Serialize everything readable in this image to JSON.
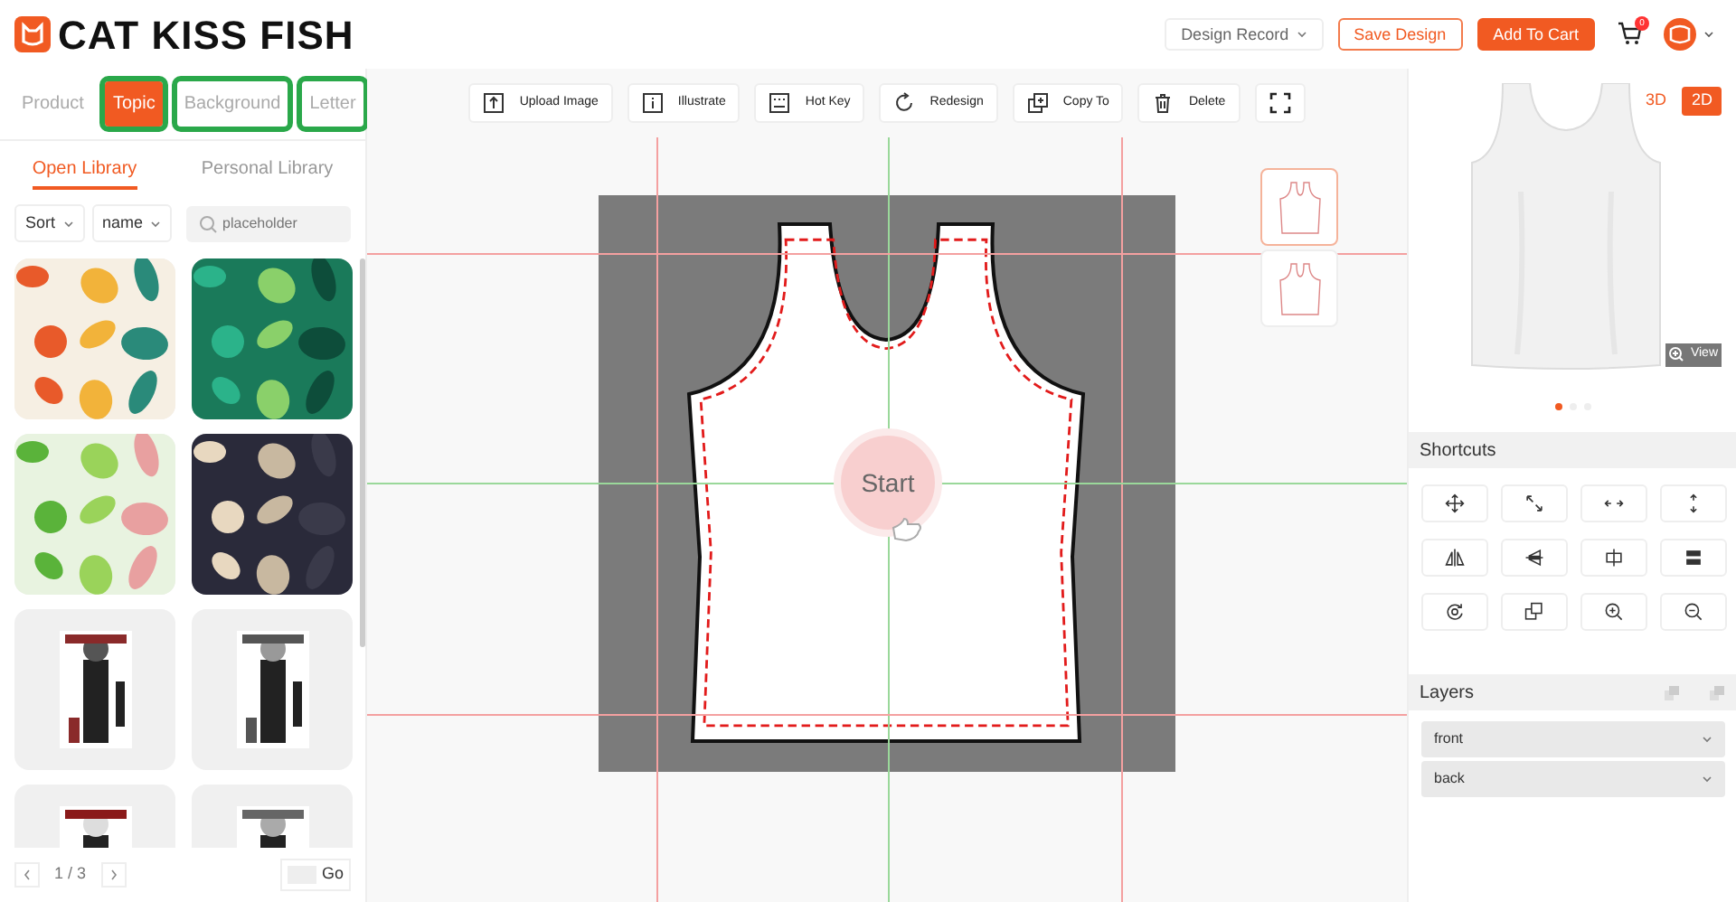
{
  "brand": "CAT KISS FISH",
  "header": {
    "design_record": "Design Record",
    "save": "Save Design",
    "add_to_cart": "Add To Cart",
    "cart_badge": "0"
  },
  "left_tabs": [
    {
      "label": "Product",
      "selected": false,
      "highlighted": false
    },
    {
      "label": "Topic",
      "selected": true,
      "highlighted": true
    },
    {
      "label": "Background",
      "selected": false,
      "highlighted": true
    },
    {
      "label": "Letter",
      "selected": false,
      "highlighted": true
    }
  ],
  "library_tabs": [
    {
      "label": "Open Library",
      "selected": true
    },
    {
      "label": "Personal Library",
      "selected": false
    }
  ],
  "filters": {
    "sort": "Sort",
    "order": "name",
    "search_placeholder": "placeholder"
  },
  "pagination": {
    "page": "1 / 3",
    "go": "Go"
  },
  "toolbar": [
    {
      "label": "Upload Image",
      "kind": "upload"
    },
    {
      "label": "Illustrate",
      "kind": "info"
    },
    {
      "label": "Hot Key",
      "kind": "keyboard"
    },
    {
      "label": "Redesign",
      "kind": "redo"
    },
    {
      "label": "Copy To",
      "kind": "copy"
    },
    {
      "label": "Delete",
      "kind": "delete"
    },
    {
      "kind": "fullscreen"
    }
  ],
  "views": [
    {
      "selected": true
    },
    {
      "selected": false
    }
  ],
  "start": "Start",
  "preview": {
    "modes": [
      {
        "label": "3D",
        "selected": false
      },
      {
        "label": "2D",
        "selected": true
      }
    ],
    "view": "View",
    "slides": [
      {
        "selected": true
      },
      {
        "selected": false
      },
      {
        "selected": false
      }
    ]
  },
  "shortcuts": {
    "title": "Shortcuts",
    "buttons": [
      {
        "kind": "move"
      },
      {
        "kind": "diagonal"
      },
      {
        "kind": "horizontal"
      },
      {
        "kind": "vertical"
      },
      {
        "kind": "flip-h"
      },
      {
        "kind": "flip-v"
      },
      {
        "kind": "center-h"
      },
      {
        "kind": "center-v"
      },
      {
        "kind": "rotate"
      },
      {
        "kind": "layer"
      },
      {
        "kind": "zoom-in"
      },
      {
        "kind": "zoom-out"
      }
    ]
  },
  "layers": {
    "title": "Layers",
    "items": [
      {
        "label": "front"
      },
      {
        "label": "back"
      }
    ]
  }
}
